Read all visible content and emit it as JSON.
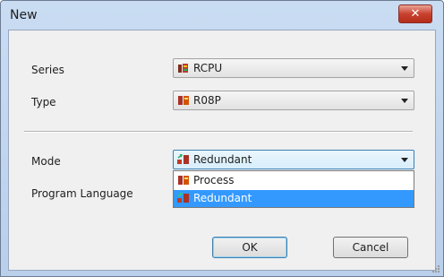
{
  "window": {
    "title": "New",
    "close_glyph": "✕"
  },
  "form": {
    "series": {
      "label": "Series",
      "value": "RCPU",
      "icon": "rcpu-chip-icon"
    },
    "type": {
      "label": "Type",
      "value": "R08P",
      "icon": "process-cpu-icon"
    },
    "mode": {
      "label": "Mode",
      "value": "Redundant",
      "icon": "redundant-icon"
    },
    "program_language": {
      "label": "Program Language"
    }
  },
  "mode_dropdown": {
    "options": [
      {
        "label": "Process",
        "icon": "process-cpu-icon",
        "selected": false
      },
      {
        "label": "Redundant",
        "icon": "redundant-icon",
        "selected": true
      }
    ]
  },
  "buttons": {
    "ok": "OK",
    "cancel": "Cancel"
  },
  "colors": {
    "selection": "#3399ff",
    "close_button": "#c8412e",
    "frame": "#b9cfea"
  }
}
